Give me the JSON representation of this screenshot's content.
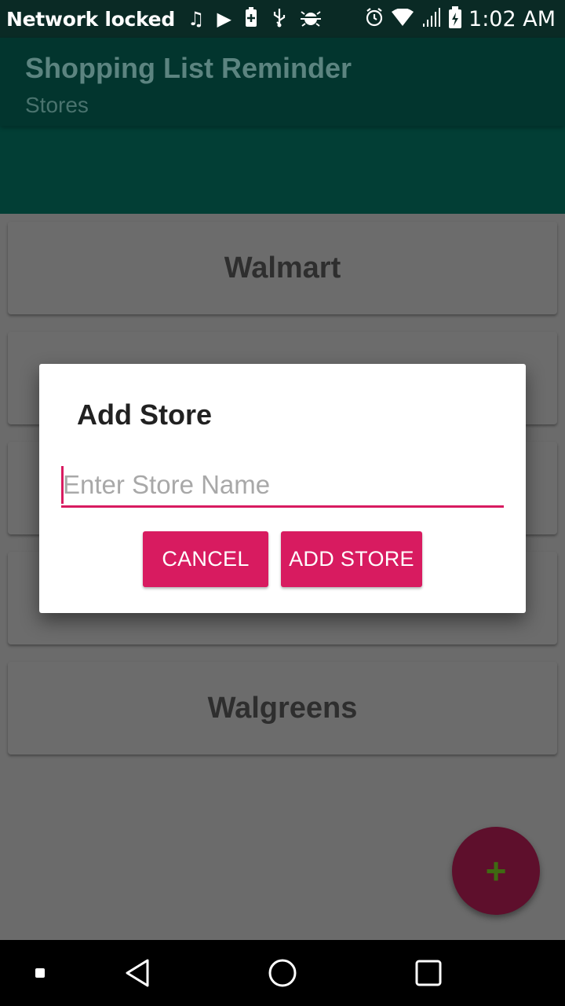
{
  "status_bar": {
    "carrier": "Network locked",
    "time": "1:02 AM",
    "left_icons": [
      "music-note-icon",
      "play-icon",
      "battery-plus-icon",
      "usb-icon",
      "android-debug-icon"
    ],
    "right_icons": [
      "alarm-icon",
      "wifi-icon",
      "signal-icon",
      "battery-charging-icon"
    ]
  },
  "app_bar": {
    "title": "Shopping List Reminder",
    "subtitle": "Stores"
  },
  "stores": {
    "items": [
      "Walmart",
      "",
      "",
      "",
      "Walgreens"
    ]
  },
  "dialog": {
    "title": "Add Store",
    "input_placeholder": "Enter Store Name",
    "input_value": "",
    "cancel_label": "CANCEL",
    "add_label": "ADD STORE"
  },
  "fab": {
    "icon": "plus-icon",
    "symbol": "+"
  },
  "nav_bar": {
    "icons": [
      "square-dot-icon",
      "back-icon",
      "home-icon",
      "recents-icon"
    ]
  },
  "colors": {
    "accent": "#d81b60",
    "primary_dark": "#0a2a25",
    "primary": "#023e35"
  }
}
